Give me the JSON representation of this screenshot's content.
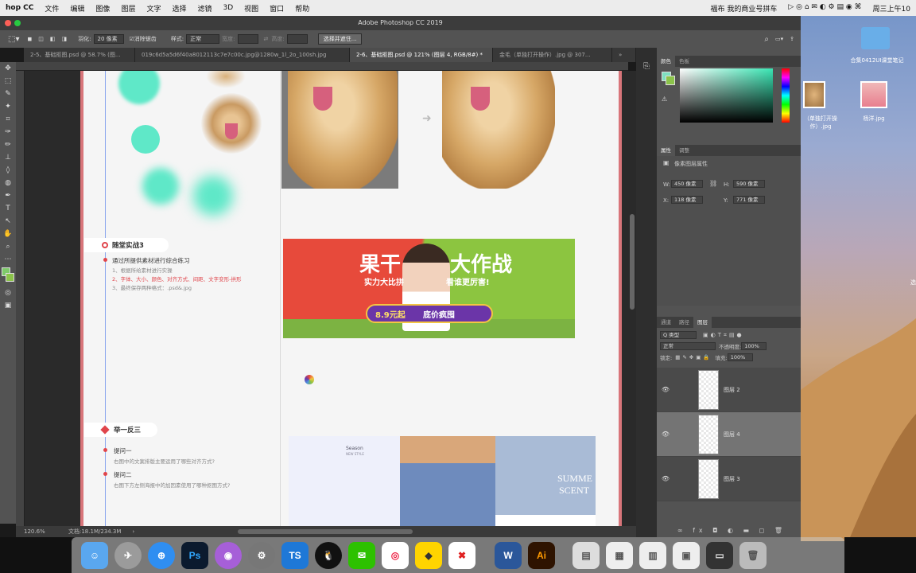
{
  "menubar": {
    "items": [
      "hop CC",
      "文件",
      "编辑",
      "图像",
      "图层",
      "文字",
      "选择",
      "滤镜",
      "3D",
      "视图",
      "窗口",
      "帮助"
    ],
    "right": "福布 我的商业号拼车",
    "time": "周三上午10"
  },
  "window": {
    "title": "Adobe Photoshop CC 2019"
  },
  "options": {
    "feather_label": "羽化:",
    "feather_value": "20 像素",
    "antialias": "消除锯齿",
    "style_label": "样式:",
    "style_value": "正常",
    "width_label": "宽度:",
    "height_label": "高度:",
    "select_mask": "选择并遮住..."
  },
  "tabs": [
    "2-5、基础抠图.psd @ 58.7% (图...",
    "019c6d5a5d6f40a8012113c7e7c00c.jpg@1280w_1l_2o_100sh.jpg",
    "2-6、基础抠图.psd @ 121% (图层 4, RGB/8#) *",
    "金毛（单独打开操作）.jpg @ 307..."
  ],
  "doc": {
    "sec3_title": "随堂实战3",
    "sec3_line1": "通过所提供素材进行综合练习",
    "sec3_line2": "1、根据所给素材进行实操",
    "sec3_line3": "2、字体、大小、颜色、对齐方式、间距、文字变形-拱形",
    "sec3_line4": "3、最终保存两种格式：.psd&.jpg",
    "sec4_title": "举一反三",
    "q1_title": "提问一",
    "q1_text": "右图中的文案排版主要运用了哪些对齐方式?",
    "q2_title": "提问二",
    "q2_text": "右图下方左侧海报中的加因素使用了哪种抠图方式?",
    "banner_big1": "果干",
    "banner_big2": "大作战",
    "banner_sub1": "实力大比拼",
    "banner_sub2": "看谁更厉害!",
    "banner_price": "8.9元起",
    "banner_ribbon": "底价疯囤",
    "season_title": "Season",
    "season_sub": "NEW STYLE",
    "summer1": "SUMME",
    "summer2": "SCENT"
  },
  "status": {
    "zoom": "120.6%",
    "doc": "文档:18.1M/234.3M"
  },
  "color_panel": {
    "tabs": [
      "颜色",
      "色板"
    ]
  },
  "props_panel": {
    "tabs": [
      "属性",
      "调整"
    ],
    "type": "像素图层属性",
    "w_label": "W:",
    "w": "450 像素",
    "h_label": "H:",
    "h": "590 像素",
    "x_label": "X:",
    "x": "118 像素",
    "y_label": "Y:",
    "y": "771 像素"
  },
  "layers_panel": {
    "tabs": [
      "通道",
      "路径",
      "图层"
    ],
    "filter": "Q 类型",
    "blend": "正常",
    "opacity_label": "不透明度:",
    "opacity": "100%",
    "lock_label": "锁定:",
    "fill_label": "填充:",
    "fill": "100%",
    "layers": [
      {
        "name": "图层 2",
        "selected": false
      },
      {
        "name": "图层 4",
        "selected": true
      },
      {
        "name": "图层 3",
        "selected": false
      }
    ]
  },
  "desktop": {
    "folder_label": "合集0412UI课堂笔记",
    "file1": "（单独打开操作）.jpg",
    "file2": "杨洋.jpg",
    "edge": "选"
  },
  "colors": {
    "accent": "#e0454b",
    "mint": "#5fe8c8",
    "banner_red": "#e74a3b",
    "banner_green": "#8cc540",
    "purple": "#6b35a8"
  },
  "dock": [
    "Finder",
    "Safari",
    "Photoshop",
    "Podcasts",
    "Prefs",
    "TeamViewer",
    "QQ",
    "WeChat",
    "Chrome",
    "Nuts",
    "Xmind",
    "Word",
    "Illustrator"
  ]
}
